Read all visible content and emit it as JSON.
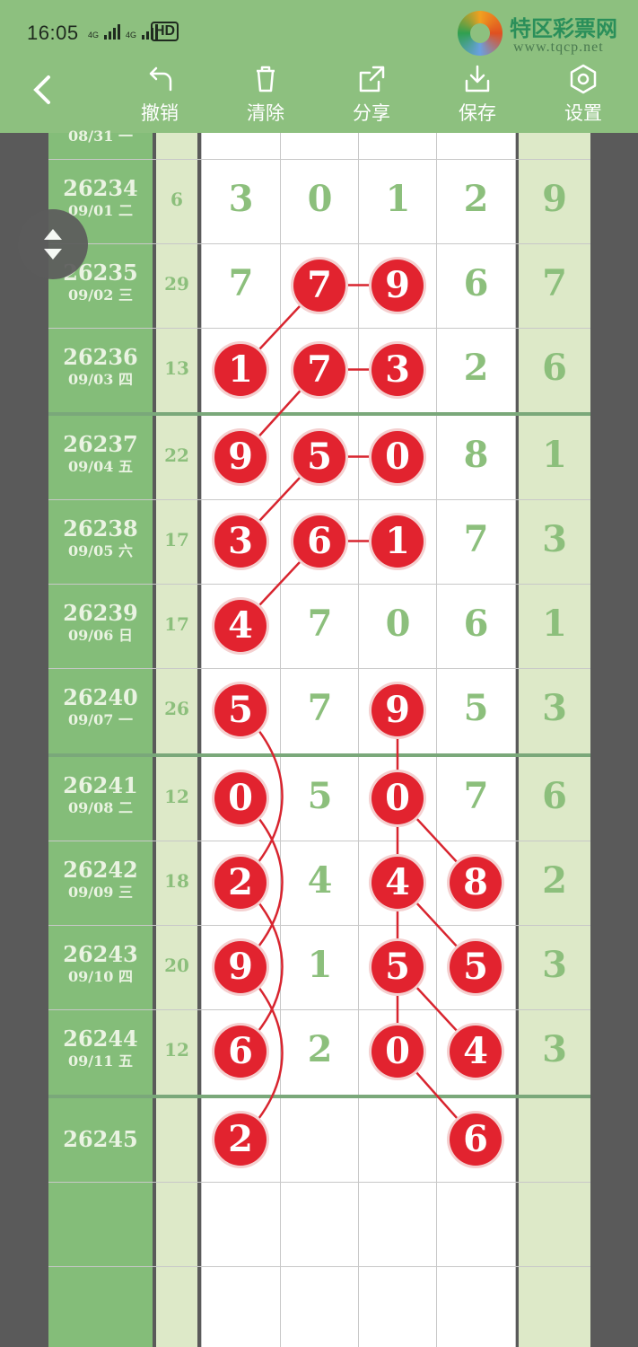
{
  "status_bar": {
    "time": "16:05",
    "network1": "4G",
    "network2": "4G",
    "hd": "HD",
    "brand": "特区彩票网",
    "brand_url": "www.tqcp.net"
  },
  "toolbar": {
    "undo_label": "撤销",
    "clear_label": "清除",
    "share_label": "分享",
    "save_label": "保存",
    "settings_label": "设置"
  },
  "partial_row": {
    "date": "08/31 一"
  },
  "rows": [
    {
      "issue": "26234",
      "date": "09/01 二",
      "sum": "6",
      "digits": [
        "3",
        "0",
        "1",
        "2"
      ],
      "last": "9"
    },
    {
      "issue": "26235",
      "date": "09/02 三",
      "sum": "29",
      "digits": [
        "7",
        "7",
        "9",
        "6"
      ],
      "last": "7"
    },
    {
      "issue": "26236",
      "date": "09/03 四",
      "sum": "13",
      "digits": [
        "1",
        "7",
        "3",
        "2"
      ],
      "last": "6"
    },
    {
      "issue": "26237",
      "date": "09/04 五",
      "sum": "22",
      "digits": [
        "9",
        "5",
        "0",
        "8"
      ],
      "last": "1"
    },
    {
      "issue": "26238",
      "date": "09/05 六",
      "sum": "17",
      "digits": [
        "3",
        "6",
        "1",
        "7"
      ],
      "last": "3"
    },
    {
      "issue": "26239",
      "date": "09/06 日",
      "sum": "17",
      "digits": [
        "4",
        "7",
        "0",
        "6"
      ],
      "last": "1"
    },
    {
      "issue": "26240",
      "date": "09/07 一",
      "sum": "26",
      "digits": [
        "5",
        "7",
        "9",
        "5"
      ],
      "last": "3"
    },
    {
      "issue": "26241",
      "date": "09/08 二",
      "sum": "12",
      "digits": [
        "0",
        "5",
        "0",
        "7"
      ],
      "last": "6"
    },
    {
      "issue": "26242",
      "date": "09/09 三",
      "sum": "18",
      "digits": [
        "2",
        "4",
        "4",
        "8"
      ],
      "last": "2"
    },
    {
      "issue": "26243",
      "date": "09/10 四",
      "sum": "20",
      "digits": [
        "9",
        "1",
        "5",
        "5"
      ],
      "last": "3"
    },
    {
      "issue": "26244",
      "date": "09/11 五",
      "sum": "12",
      "digits": [
        "6",
        "2",
        "0",
        "4"
      ],
      "last": "3"
    },
    {
      "issue": "26245",
      "date": "",
      "sum": "",
      "digits": [
        "2",
        "",
        "",
        "6"
      ],
      "last": ""
    }
  ],
  "marked": [
    [
      1,
      1
    ],
    [
      1,
      2
    ],
    [
      2,
      0
    ],
    [
      2,
      1
    ],
    [
      2,
      2
    ],
    [
      3,
      0
    ],
    [
      3,
      1
    ],
    [
      3,
      2
    ],
    [
      4,
      0
    ],
    [
      4,
      1
    ],
    [
      4,
      2
    ],
    [
      5,
      0
    ],
    [
      6,
      0
    ],
    [
      6,
      2
    ],
    [
      7,
      0
    ],
    [
      7,
      2
    ],
    [
      8,
      0
    ],
    [
      8,
      2
    ],
    [
      8,
      3
    ],
    [
      9,
      0
    ],
    [
      9,
      2
    ],
    [
      9,
      3
    ],
    [
      10,
      0
    ],
    [
      10,
      2
    ],
    [
      10,
      3
    ],
    [
      11,
      0
    ],
    [
      11,
      3
    ]
  ],
  "colors": {
    "header": "#8dc07f",
    "ball": "#e2232f",
    "digit": "#8cbf7c",
    "issue_bg": "#84bd79"
  }
}
